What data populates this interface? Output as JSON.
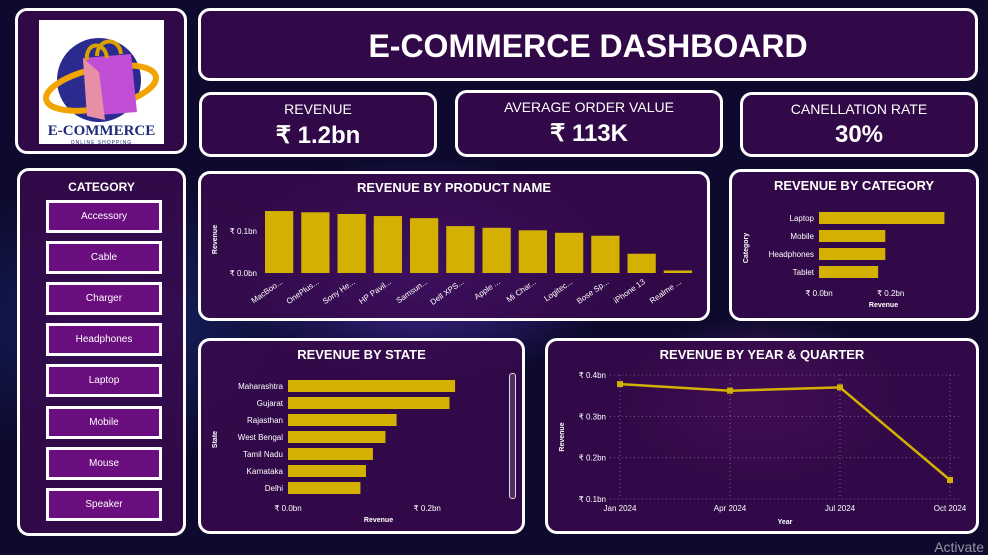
{
  "header": {
    "title": "E-COMMERCE DASHBOARD"
  },
  "logo": {
    "brand": "E-COMMERCE",
    "tagline": "ONLINE SHOPPING"
  },
  "kpis": [
    {
      "label": "REVENUE",
      "value": "₹ 1.2bn"
    },
    {
      "label": "AVERAGE ORDER VALUE",
      "value": "₹ 113K"
    },
    {
      "label": "CANELLATION RATE",
      "value": "30%"
    }
  ],
  "category_slicer": {
    "title": "CATEGORY",
    "items": [
      "Accessory",
      "Cable",
      "Charger",
      "Headphones",
      "Laptop",
      "Mobile",
      "Mouse",
      "Speaker"
    ]
  },
  "watermark": "Activate",
  "colors": {
    "bar": "#d4b000",
    "panel_bg": "#3a0a4e",
    "button_bg": "#6a0d7e"
  },
  "chart_data": [
    {
      "id": "product",
      "type": "bar",
      "title": "REVENUE BY PRODUCT NAME",
      "ylabel": "Revenue",
      "xlabel": "",
      "categories": [
        "MacBoo...",
        "OnePlus...",
        "Sony He...",
        "HP Pavil...",
        "Samsun...",
        "Dell XPS...",
        "Apple ...",
        "Mi Char...",
        "Logitec...",
        "Bose Sp...",
        "iPhone 13",
        "Realme ..."
      ],
      "values": [
        0.148,
        0.145,
        0.141,
        0.136,
        0.131,
        0.112,
        0.108,
        0.102,
        0.096,
        0.089,
        0.046,
        0.006
      ],
      "ylim": [
        0,
        0.16
      ],
      "ticks": [
        {
          "v": 0,
          "label": "₹ 0.0bn"
        },
        {
          "v": 0.1,
          "label": "₹ 0.1bn"
        }
      ]
    },
    {
      "id": "category",
      "type": "bar",
      "orientation": "horizontal",
      "title": "REVENUE BY CATEGORY",
      "ylabel": "Category",
      "xlabel": "Revenue",
      "categories": [
        "Laptop",
        "Mobile",
        "Headphones",
        "Tablet"
      ],
      "values": [
        0.35,
        0.185,
        0.185,
        0.165
      ],
      "xlim": [
        0,
        0.36
      ],
      "ticks": [
        {
          "v": 0,
          "label": "₹ 0.0bn"
        },
        {
          "v": 0.2,
          "label": "₹ 0.2bn"
        }
      ]
    },
    {
      "id": "state",
      "type": "bar",
      "orientation": "horizontal",
      "title": "REVENUE BY STATE",
      "ylabel": "State",
      "xlabel": "Revenue",
      "categories": [
        "Maharashtra",
        "Gujarat",
        "Rajasthan",
        "West Bengal",
        "Tamil Nadu",
        "Karnataka",
        "Delhi"
      ],
      "values": [
        0.24,
        0.232,
        0.156,
        0.14,
        0.122,
        0.112,
        0.104
      ],
      "xlim": [
        0,
        0.26
      ],
      "ticks": [
        {
          "v": 0,
          "label": "₹ 0.0bn"
        },
        {
          "v": 0.2,
          "label": "₹ 0.2bn"
        }
      ]
    },
    {
      "id": "quarter",
      "type": "line",
      "title": "REVENUE BY YEAR & QUARTER",
      "ylabel": "Revenue",
      "xlabel": "Year",
      "categories": [
        "Jan 2024",
        "Apr 2024",
        "Jul 2024",
        "Oct 2024"
      ],
      "values": [
        0.378,
        0.362,
        0.37,
        0.146
      ],
      "ylim": [
        0.1,
        0.4
      ],
      "ticks": [
        {
          "v": 0.1,
          "label": "₹ 0.1bn"
        },
        {
          "v": 0.2,
          "label": "₹ 0.2bn"
        },
        {
          "v": 0.3,
          "label": "₹ 0.3bn"
        },
        {
          "v": 0.4,
          "label": "₹ 0.4bn"
        }
      ]
    }
  ]
}
